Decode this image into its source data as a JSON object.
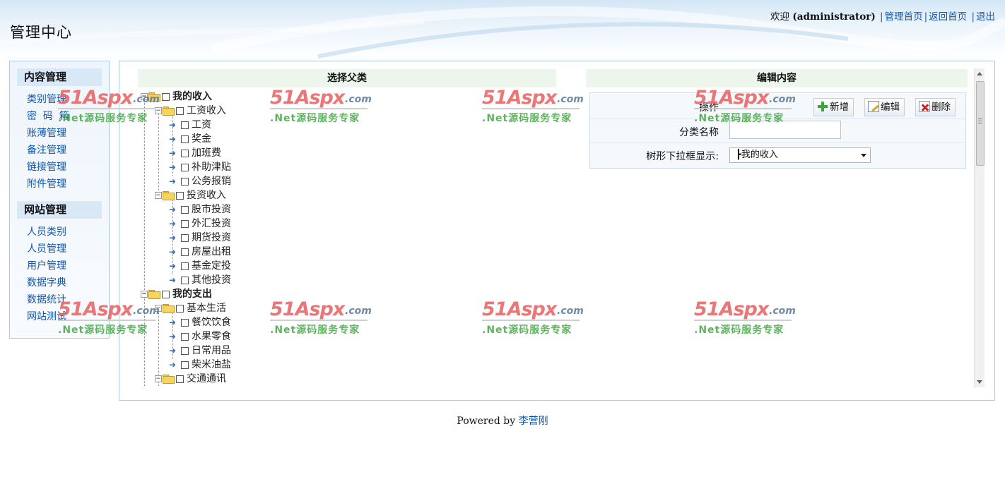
{
  "header": {
    "site_title": "管理中心",
    "welcome": "欢迎",
    "username": "(administrator)",
    "links": [
      "管理首页",
      "返回首页",
      "退出"
    ]
  },
  "sidebar": {
    "sections": [
      {
        "title": "内容管理",
        "items": [
          "类别管理",
          "密  码  箱",
          "账薄管理",
          "备注管理",
          "链接管理",
          "附件管理"
        ]
      },
      {
        "title": "网站管理",
        "items": [
          "人员类别",
          "人员管理",
          "用户管理",
          "数据字典",
          "数据统计",
          "网站测试"
        ]
      }
    ]
  },
  "main": {
    "left_title": "选择父类",
    "right_title": "编辑内容",
    "tree": {
      "root1": "我的收入",
      "g1": "工资收入",
      "g1_items": [
        "工资",
        "奖金",
        "加班费",
        "补助津贴",
        "公务报销"
      ],
      "g2": "投资收入",
      "g2_items": [
        "股市投资",
        "外汇投资",
        "期货投资",
        "房屋出租",
        "基金定投",
        "其他投资"
      ],
      "root2": "我的支出",
      "g3": "基本生活",
      "g3_items": [
        "餐饮饮食",
        "水果零食",
        "日常用品",
        "柴米油盐"
      ],
      "g4": "交通通讯"
    },
    "form": {
      "op_label": "操作",
      "btn_add": "新增",
      "btn_edit": "编辑",
      "btn_delete": "删除",
      "name_label": "分类名称",
      "name_value": "",
      "select_label": "树形下拉框显示:",
      "select_value": "┣我的收入"
    }
  },
  "footer": {
    "powered": "Powered by",
    "author": "李营刚"
  },
  "watermark": {
    "brand": "51Aspx",
    "domain": ".com",
    "slogan": ".Net源码服务专家"
  },
  "colors": {
    "link": "#1155aa",
    "border": "#a9cbe6",
    "column_header_bg": "#edf6ed",
    "watermark_red": "#e86565",
    "watermark_green": "#4aa84a"
  }
}
